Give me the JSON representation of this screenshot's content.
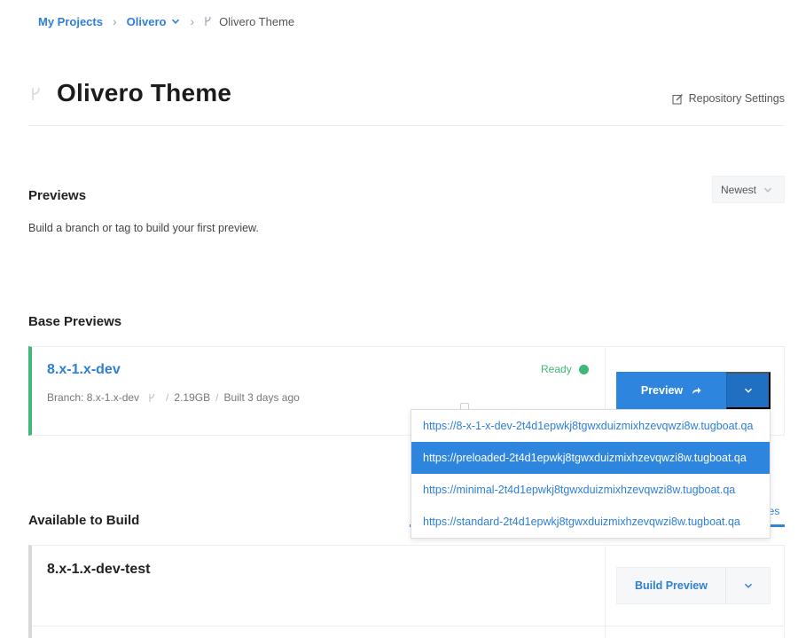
{
  "breadcrumb": {
    "project": "My Projects",
    "repo": "Olivero",
    "current": "Olivero Theme"
  },
  "page": {
    "title": "Olivero Theme",
    "repo_settings": "Repository Settings"
  },
  "previews": {
    "title": "Previews",
    "empty_message": "Build a branch or tag to build your first preview.",
    "sort_value": "Newest"
  },
  "base_previews": {
    "title": "Base Previews",
    "item": {
      "name": "8.x-1.x-dev",
      "branch": "Branch: 8.x-1.x-dev",
      "size": "2.19GB",
      "built": "Built 3 days ago",
      "status": "Ready",
      "preview_label": "Preview"
    },
    "urls": [
      "https://8-x-1-x-dev-2t4d1epwkj8tgwxduizmixhzevqwzi8w.tugboat.qa",
      "https://preloaded-2t4d1epwkj8tgwxduizmixhzevqwzi8w.tugboat.qa",
      "https://minimal-2t4d1epwkj8tgwxduizmixhzevqwzi8w.tugboat.qa",
      "https://standard-2t4d1epwkj8tgwxduizmixhzevqwzi8w.tugboat.qa"
    ],
    "active_url_index": 1
  },
  "available": {
    "title": "Available to Build",
    "tab_fragment": "nes",
    "item": {
      "name": "8.x-1.x-dev-test",
      "build_label": "Build Preview"
    }
  },
  "colors": {
    "accent": "#2e85dd",
    "ready": "#3fb778"
  }
}
